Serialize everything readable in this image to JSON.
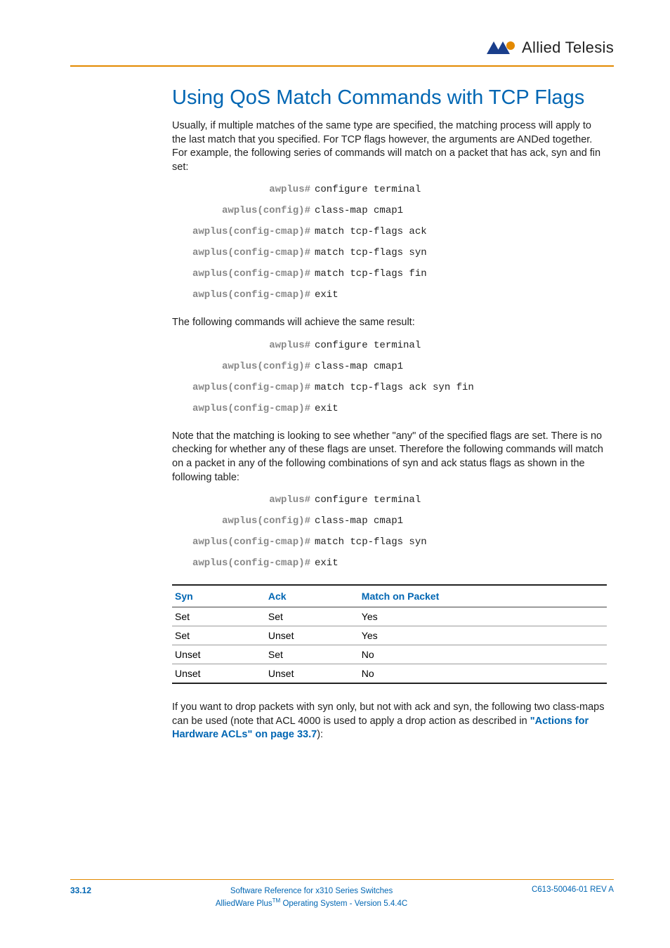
{
  "brand": "Allied Telesis",
  "heading": "Using QoS Match Commands with TCP Flags",
  "para1": "Usually, if multiple matches of the same type are specified, the matching process will apply to the last match that you specified. For TCP flags however, the arguments are ANDed together. For example, the following series of commands will match on a packet that has ack, syn and fin set:",
  "block1": [
    {
      "prompt": "awplus#",
      "cmd": "configure terminal"
    },
    {
      "prompt": "awplus(config)#",
      "cmd": "class-map cmap1"
    },
    {
      "prompt": "awplus(config-cmap)#",
      "cmd": "match tcp-flags ack"
    },
    {
      "prompt": "awplus(config-cmap)#",
      "cmd": "match tcp-flags syn"
    },
    {
      "prompt": "awplus(config-cmap)#",
      "cmd": "match tcp-flags fin"
    },
    {
      "prompt": "awplus(config-cmap)#",
      "cmd": "exit"
    }
  ],
  "para2": "The following commands will achieve the same result:",
  "block2": [
    {
      "prompt": "awplus#",
      "cmd": "configure terminal"
    },
    {
      "prompt": "awplus(config)#",
      "cmd": "class-map cmap1"
    },
    {
      "prompt": "awplus(config-cmap)#",
      "cmd": "match tcp-flags ack syn fin"
    },
    {
      "prompt": "awplus(config-cmap)#",
      "cmd": "exit"
    }
  ],
  "para3": "Note that the matching is looking to see whether \"any\" of the specified flags are set. There is no checking for whether any of these flags are unset. Therefore the following commands will match on a packet in any of the following combinations of syn and ack status flags as shown in the following table:",
  "block3": [
    {
      "prompt": "awplus#",
      "cmd": "configure terminal"
    },
    {
      "prompt": "awplus(config)#",
      "cmd": "class-map cmap1"
    },
    {
      "prompt": "awplus(config-cmap)#",
      "cmd": "match tcp-flags syn"
    },
    {
      "prompt": "awplus(config-cmap)#",
      "cmd": "exit"
    }
  ],
  "table": {
    "headers": [
      "Syn",
      "Ack",
      "Match on Packet"
    ],
    "rows": [
      [
        "Set",
        "Set",
        "Yes"
      ],
      [
        "Set",
        "Unset",
        "Yes"
      ],
      [
        "Unset",
        "Set",
        "No"
      ],
      [
        "Unset",
        "Unset",
        "No"
      ]
    ]
  },
  "para4a": "If you want to drop packets with syn only, but not with ack and syn, the following two class-maps can be used (note that ACL 4000 is used to apply a drop action as described in ",
  "para4link": "\"Actions for Hardware ACLs\" on page 33.7",
  "para4b": "):",
  "footer": {
    "page": "33.12",
    "center1": "Software Reference for x310 Series Switches",
    "center2a": "AlliedWare Plus",
    "center2b": " Operating System  -  Version 5.4.4C",
    "right": "C613-50046-01 REV A"
  }
}
